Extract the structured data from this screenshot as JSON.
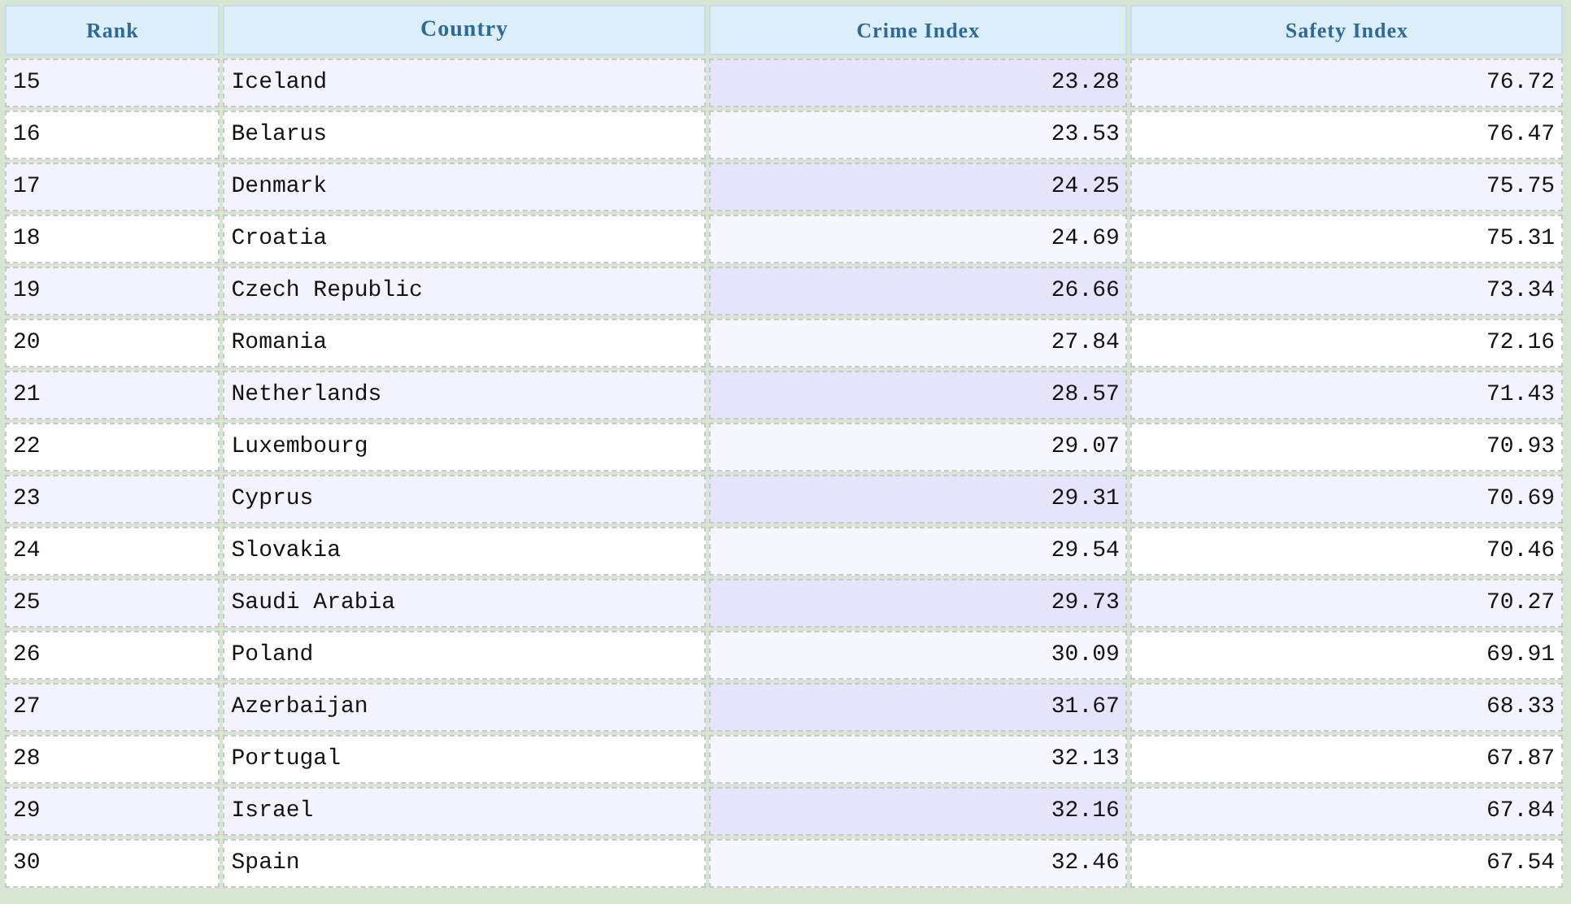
{
  "table": {
    "columns": [
      {
        "label": "Rank",
        "numeric": false,
        "sorted": false
      },
      {
        "label": "Country",
        "numeric": false,
        "sorted": false
      },
      {
        "label": "Crime Index",
        "numeric": true,
        "sorted": true
      },
      {
        "label": "Safety Index",
        "numeric": true,
        "sorted": false
      }
    ],
    "rows": [
      [
        "15",
        "Iceland",
        "23.28",
        "76.72"
      ],
      [
        "16",
        "Belarus",
        "23.53",
        "76.47"
      ],
      [
        "17",
        "Denmark",
        "24.25",
        "75.75"
      ],
      [
        "18",
        "Croatia",
        "24.69",
        "75.31"
      ],
      [
        "19",
        "Czech Republic",
        "26.66",
        "73.34"
      ],
      [
        "20",
        "Romania",
        "27.84",
        "72.16"
      ],
      [
        "21",
        "Netherlands",
        "28.57",
        "71.43"
      ],
      [
        "22",
        "Luxembourg",
        "29.07",
        "70.93"
      ],
      [
        "23",
        "Cyprus",
        "29.31",
        "70.69"
      ],
      [
        "24",
        "Slovakia",
        "29.54",
        "70.46"
      ],
      [
        "25",
        "Saudi Arabia",
        "29.73",
        "70.27"
      ],
      [
        "26",
        "Poland",
        "30.09",
        "69.91"
      ],
      [
        "27",
        "Azerbaijan",
        "31.67",
        "68.33"
      ],
      [
        "28",
        "Portugal",
        "32.13",
        "67.87"
      ],
      [
        "29",
        "Israel",
        "32.16",
        "67.84"
      ],
      [
        "30",
        "Spain",
        "32.46",
        "67.54"
      ]
    ]
  }
}
